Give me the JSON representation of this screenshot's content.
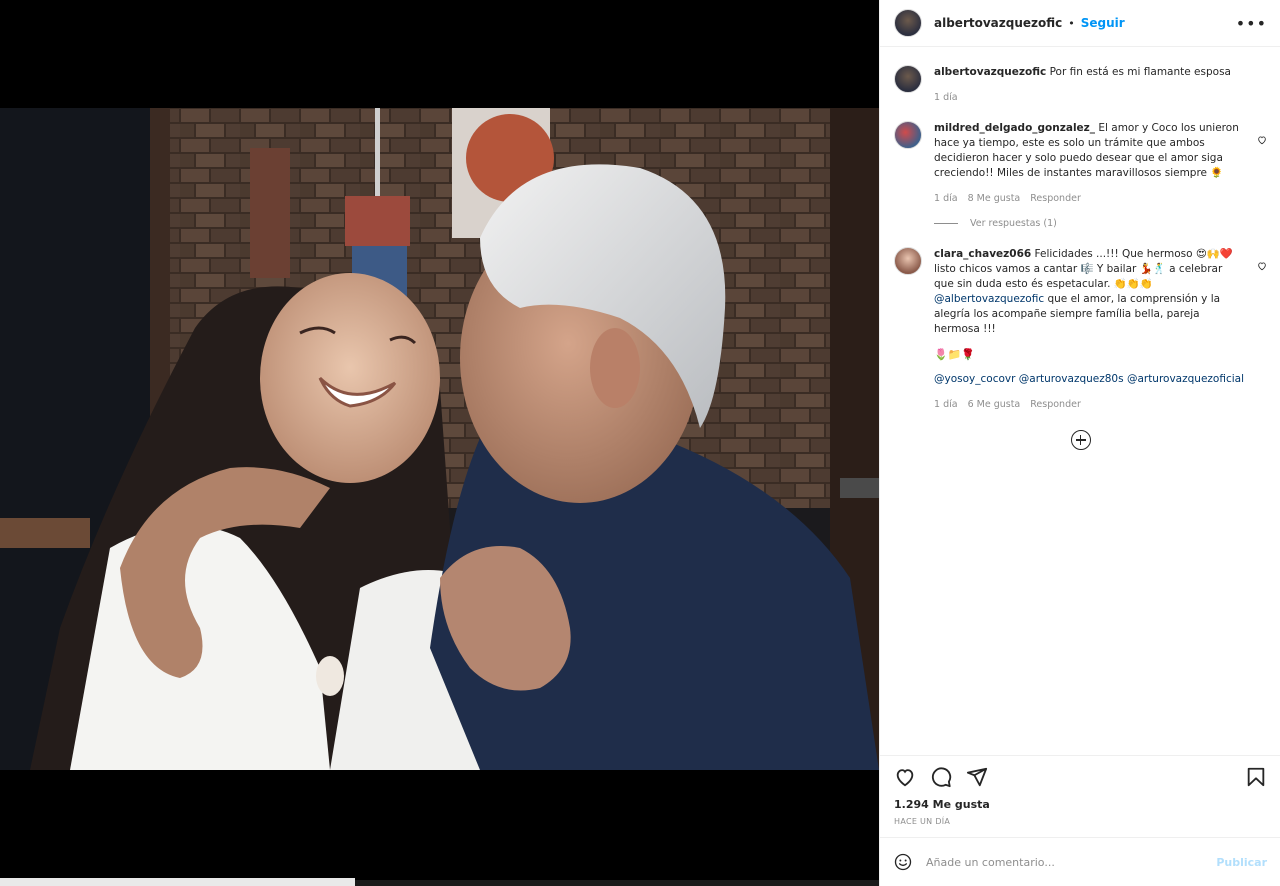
{
  "post": {
    "username": "albertovazquezofic",
    "follow_label": "Seguir",
    "more_label": "•••",
    "caption_user": "albertovazquezofic",
    "caption_text": "Por fin está es mi flamante esposa",
    "caption_time": "1 día"
  },
  "comments": [
    {
      "user": "mildred_delgado_gonzalez_",
      "text": "El amor y Coco los unieron hace ya tiempo, este es solo un trámite que ambos decidieron hacer y solo puedo desear que el amor siga creciendo!! Miles de instantes maravillosos siempre 🌻",
      "time": "1 día",
      "likes": "8 Me gusta",
      "reply": "Responder",
      "replies_label": "Ver respuestas (1)"
    },
    {
      "user": "clara_chavez066",
      "text": "Felicidades ...!!! Que hermoso 😍🙌❤️ listo chicos vamos a cantar 🎼 Y bailar 💃🕺 a celebrar que sin duda esto és espetacular. 👏👏👏",
      "mention_inline": "@albertovazquezofic",
      "text2": "que el amor, la comprensión y la alegría los acompañe siempre família bella, pareja hermosa !!!",
      "emoji_line": "🌷📁🌹",
      "mentions": [
        "@yosoy_cocovr",
        "@arturovazquez80s",
        "@arturovazquezoficial"
      ],
      "time": "1 día",
      "likes": "6 Me gusta",
      "reply": "Responder"
    }
  ],
  "footer": {
    "likes": "1.294 Me gusta",
    "time": "HACE UN DÍA",
    "comment_placeholder": "Añade un comentario...",
    "publish_label": "Publicar"
  },
  "icons": [
    "heart-icon",
    "comment-icon",
    "share-icon",
    "bookmark-icon",
    "emoji-icon",
    "more-icon",
    "load-more-icon"
  ],
  "colors": {
    "accent": "#0095f6",
    "link": "#00376b",
    "muted": "#8e8e8e",
    "text": "#262626"
  }
}
